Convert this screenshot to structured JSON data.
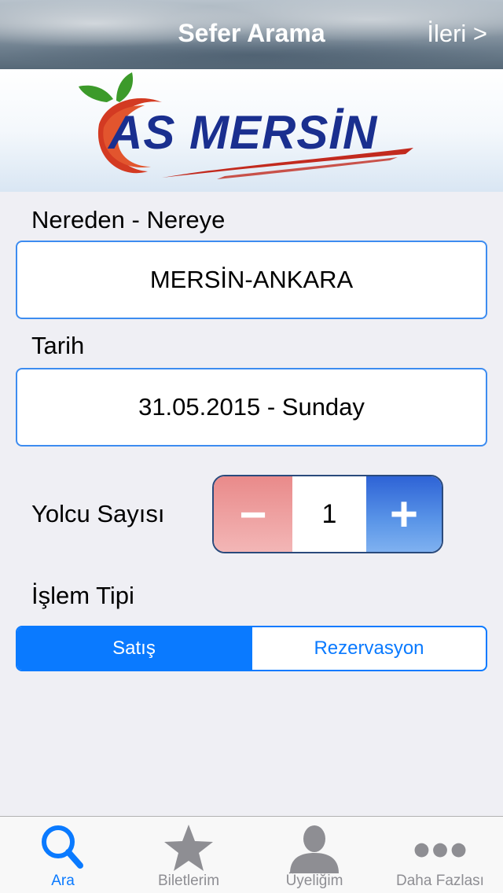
{
  "nav": {
    "title": "Sefer Arama",
    "next": "İleri >"
  },
  "banner": {
    "logo_text": "AS MERSİN"
  },
  "route": {
    "label": "Nereden - Nereye",
    "value": "MERSİN-ANKARA"
  },
  "date": {
    "label": "Tarih",
    "value": "31.05.2015 - Sunday"
  },
  "passengers": {
    "label": "Yolcu Sayısı",
    "minus": "−",
    "value": "1",
    "plus": "+"
  },
  "transaction": {
    "label": "İşlem Tipi",
    "options": [
      "Satış",
      "Rezervasyon"
    ],
    "selected": "Satış"
  },
  "tabs": [
    {
      "label": "Ara",
      "icon": "search-icon",
      "active": true
    },
    {
      "label": "Biletlerim",
      "icon": "star-icon",
      "active": false
    },
    {
      "label": "Üyeliğim",
      "icon": "person-icon",
      "active": false
    },
    {
      "label": "Daha Fazlası",
      "icon": "more-icon",
      "active": false
    }
  ],
  "colors": {
    "accent": "#0a7aff",
    "brand_blue": "#1a2f8f",
    "brand_red": "#d33a22",
    "minus_red": "#e98a8a",
    "plus_blue": "#2e63d6"
  }
}
